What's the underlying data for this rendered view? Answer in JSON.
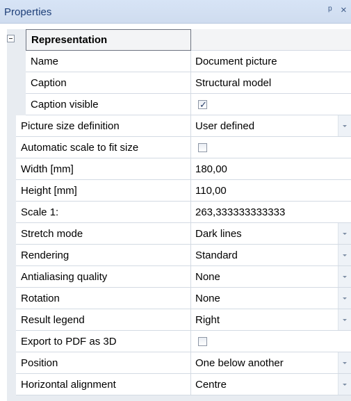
{
  "panel": {
    "title": "Properties",
    "pin_icon": "pin-icon",
    "close_icon": "close-icon"
  },
  "section": {
    "label": "Representation",
    "expander_icon": "collapse-icon"
  },
  "rows": [
    {
      "label": "Name",
      "value": "Document picture",
      "type": "text",
      "sub": true
    },
    {
      "label": "Caption",
      "value": "Structural model",
      "type": "text",
      "sub": true
    },
    {
      "label": "Caption visible",
      "value": "",
      "type": "checkbox",
      "checked": true,
      "sub": true
    },
    {
      "label": "Picture size definition",
      "value": "User defined",
      "type": "dropdown"
    },
    {
      "label": "Automatic scale to fit size",
      "value": "",
      "type": "checkbox",
      "checked": false
    },
    {
      "label": "Width [mm]",
      "value": "180,00",
      "type": "text"
    },
    {
      "label": "Height [mm]",
      "value": "110,00",
      "type": "text"
    },
    {
      "label": "Scale 1:",
      "value": "263,333333333333",
      "type": "text"
    },
    {
      "label": "Stretch mode",
      "value": "Dark lines",
      "type": "dropdown"
    },
    {
      "label": "Rendering",
      "value": "Standard",
      "type": "dropdown"
    },
    {
      "label": "Antialiasing quality",
      "value": "None",
      "type": "dropdown"
    },
    {
      "label": "Rotation",
      "value": "None",
      "type": "dropdown"
    },
    {
      "label": "Result legend",
      "value": "Right",
      "type": "dropdown"
    },
    {
      "label": "Export to PDF as 3D",
      "value": "",
      "type": "checkbox",
      "checked": false
    },
    {
      "label": "Position",
      "value": "One below another",
      "type": "dropdown"
    },
    {
      "label": "Horizontal alignment",
      "value": "Centre",
      "type": "dropdown"
    }
  ],
  "check_glyph": "✓"
}
